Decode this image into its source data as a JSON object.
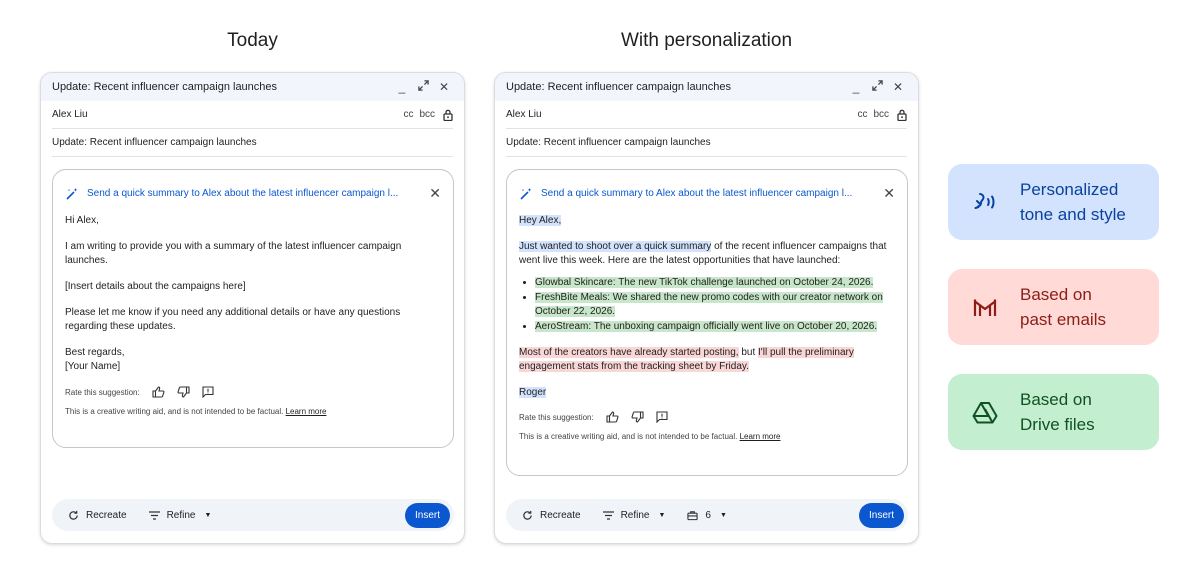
{
  "headings": {
    "today": "Today",
    "personalized": "With personalization"
  },
  "left": {
    "window_title": "Update: Recent influencer campaign launches",
    "to": "Alex Liu",
    "cc": "cc",
    "bcc": "bcc",
    "subject": "Update: Recent influencer campaign launches",
    "prompt": "Send a quick summary to Alex about the latest influencer campaign l...",
    "greeting": "Hi Alex,",
    "para1": "I am writing to provide you with a summary of the latest influencer campaign launches.",
    "para2": "[Insert details about the campaigns here]",
    "para3": "Please let me know if you need any additional details or have any questions regarding these updates.",
    "signoff": "Best regards,",
    "signname": "[Your Name]",
    "rate_label": "Rate this suggestion:",
    "disclaimer": "This is a creative writing aid, and is not intended to be factual.",
    "learn_more": "Learn more",
    "recreate": "Recreate",
    "refine": "Refine",
    "insert": "Insert"
  },
  "right": {
    "window_title": "Update: Recent influencer campaign launches",
    "to": "Alex Liu",
    "cc": "cc",
    "bcc": "bcc",
    "subject": "Update: Recent influencer campaign launches",
    "prompt": "Send a quick summary to Alex about the latest influencer campaign l...",
    "greeting": "Hey Alex,",
    "para1_hl": "Just wanted to shoot over a quick summary",
    "para1_rest": " of the recent influencer campaigns that went live this week. Here are the latest opportunities that have launched:",
    "bullets": [
      "Glowbal Skincare: The new TikTok challenge launched on October 24, 2026.",
      "FreshBite Meals: We shared the new promo codes with our creator network on October 22, 2026.",
      "AeroStream: The unboxing campaign officially went live on October 20, 2026."
    ],
    "para2_a": "Most of the creators have already started posting,",
    "para2_b": " but ",
    "para2_c": "I'll pull the preliminary engagement stats from the tracking sheet by Friday.",
    "signname": "Roger",
    "rate_label": "Rate this suggestion:",
    "disclaimer": "This is a creative writing aid, and is not intended to be factual.",
    "learn_more": "Learn more",
    "recreate": "Recreate",
    "refine": "Refine",
    "attach_count": "6",
    "insert": "Insert"
  },
  "features": [
    {
      "line1": "Personalized",
      "line2": "tone and style",
      "icon": "voice-icon",
      "color": "#0842a0"
    },
    {
      "line1": "Based on",
      "line2": "past emails",
      "icon": "gmail-icon",
      "color": "#8c1d18"
    },
    {
      "line1": "Based on",
      "line2": "Drive files",
      "icon": "drive-icon",
      "color": "#0f5223"
    }
  ]
}
